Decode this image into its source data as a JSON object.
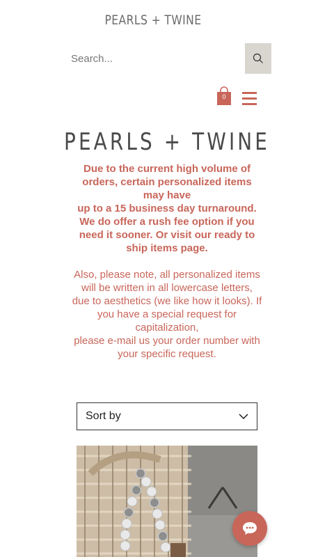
{
  "header": {
    "logo_small": "PEARLS + TWINE",
    "search_placeholder": "Search...",
    "cart_count": "0"
  },
  "main": {
    "logo_big": "PEARLS + TWINE",
    "notice_bold": [
      "Due to the current high volume of orders, certain personalized items may have",
      "up to a 15 business day turnaround.",
      "We do offer a rush fee option if you need it sooner. Or visit our ready to ship items page."
    ],
    "notice_regular": [
      "Also, please note, all personalized items will be written in all lowercase letters,",
      "due to aesthetics (we like how it looks). If you have a special request for capitalization,",
      "please e-mail us your order number with your specific request."
    ],
    "sort_label": "Sort by"
  },
  "colors": {
    "accent": "#c8665a",
    "search_button": "#d9d6d0",
    "logo_text": "#4a4a4a"
  },
  "icons": {
    "search": "search-icon",
    "cart": "cart-icon",
    "menu": "hamburger-menu-icon",
    "sort": "chevron-down-icon",
    "chat": "chat-icon"
  }
}
